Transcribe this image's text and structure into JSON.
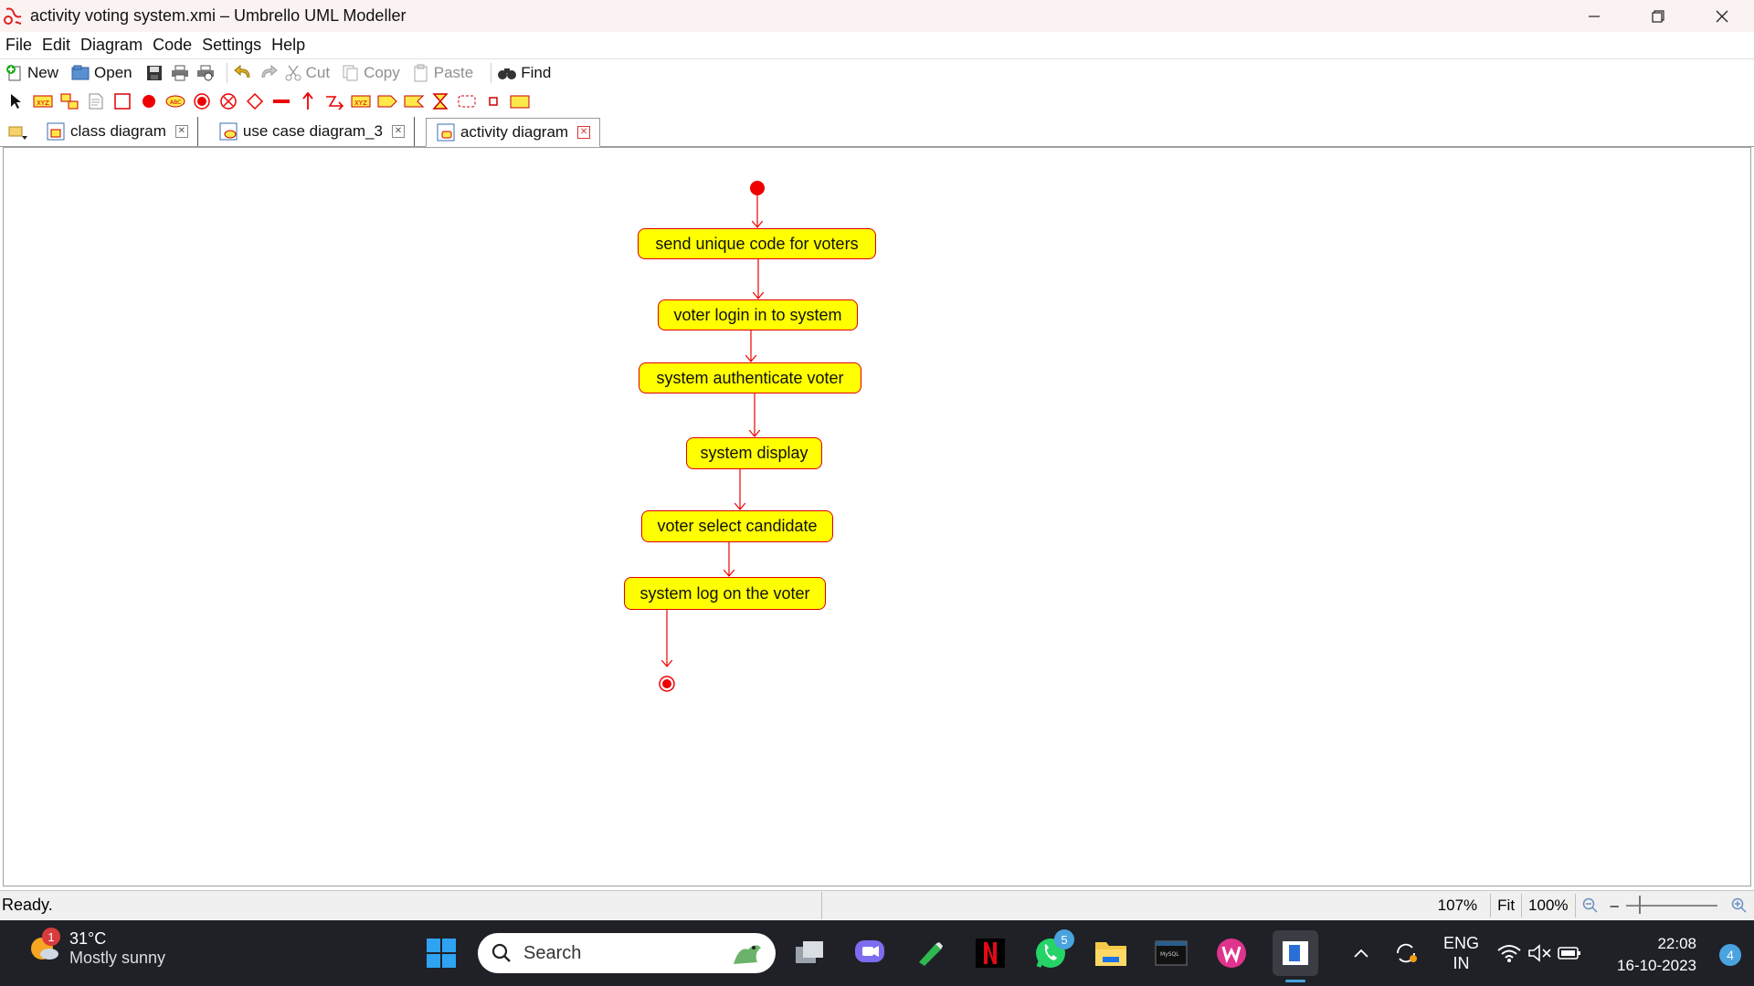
{
  "window": {
    "title": "activity voting system.xmi – Umbrello UML Modeller",
    "controls": [
      "minimize",
      "restore",
      "close"
    ]
  },
  "menu": [
    "File",
    "Edit",
    "Diagram",
    "Code",
    "Settings",
    "Help"
  ],
  "toolbar": {
    "new_label": "New",
    "open_label": "Open",
    "cut_label": "Cut",
    "copy_label": "Copy",
    "paste_label": "Paste",
    "find_label": "Find"
  },
  "diagram_tools": [
    "select-arrow",
    "object-node",
    "activity",
    "note",
    "box",
    "initial-state",
    "text-label",
    "end-state",
    "final-activity",
    "branch",
    "fork-join",
    "dependency",
    "anchor",
    "pre-condition",
    "send-signal",
    "accept-signal",
    "accept-time",
    "region",
    "pin",
    "object"
  ],
  "tabs": [
    {
      "label": "class diagram",
      "active": false
    },
    {
      "label": "use case diagram_3",
      "active": false
    },
    {
      "label": "activity diagram",
      "active": true
    }
  ],
  "diagram": {
    "activities": [
      {
        "label": "send unique code for voters"
      },
      {
        "label": "voter login in to system"
      },
      {
        "label": "system authenticate voter"
      },
      {
        "label": "system display"
      },
      {
        "label": "voter select candidate"
      },
      {
        "label": "system log on the voter"
      }
    ],
    "colors": {
      "fill": "#ffff00",
      "stroke": "#e00000"
    }
  },
  "status": {
    "text": "Ready.",
    "zoom": "107%",
    "fit_label": "Fit",
    "reset_label": "100%"
  },
  "taskbar": {
    "weather": {
      "temp": "31°C",
      "condition": "Mostly sunny",
      "badge": "1"
    },
    "search_placeholder": "Search",
    "whatsapp_badge": "5",
    "lang_top": "ENG",
    "lang_bottom": "IN",
    "time": "22:08",
    "date": "16-10-2023",
    "notifications": "4"
  }
}
